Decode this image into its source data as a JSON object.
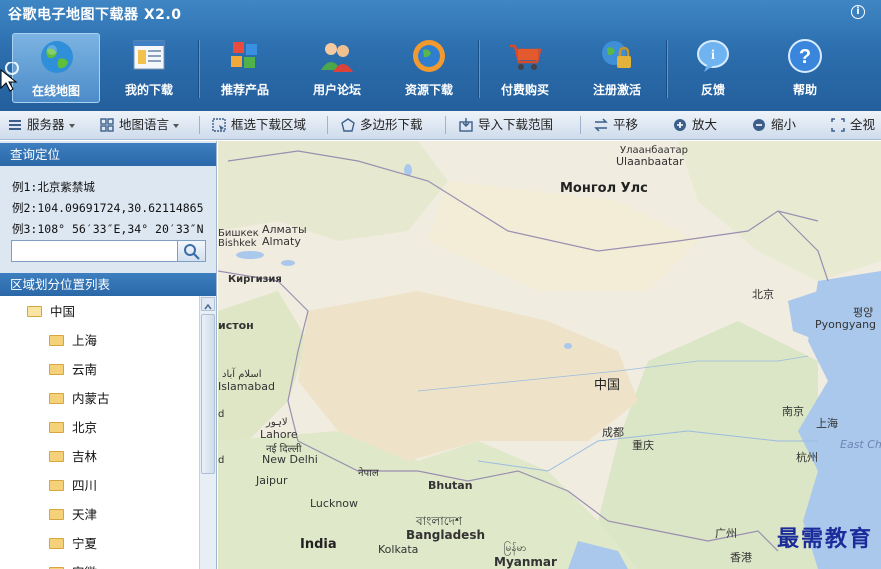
{
  "app": {
    "title": "谷歌电子地图下载器 X2.0",
    "info_icon": "info-icon"
  },
  "ribbon": {
    "buttons": [
      {
        "label": "在线地图",
        "icon": "globe-icon",
        "active": true
      },
      {
        "label": "我的下载",
        "icon": "download-list-icon",
        "active": false
      },
      {
        "label": "推荐产品",
        "icon": "cubes-icon",
        "active": false
      },
      {
        "label": "用户论坛",
        "icon": "users-icon",
        "active": false
      },
      {
        "label": "资源下载",
        "icon": "resource-globe-icon",
        "active": false
      },
      {
        "label": "付费购买",
        "icon": "cart-icon",
        "active": false
      },
      {
        "label": "注册激活",
        "icon": "lock-globe-icon",
        "active": false
      },
      {
        "label": "反馈",
        "icon": "feedback-icon",
        "active": false
      },
      {
        "label": "帮助",
        "icon": "help-icon",
        "active": false
      }
    ]
  },
  "toolbar": {
    "server": "服务器",
    "map_language": "地图语言",
    "box_select": "框选下载区域",
    "polygon": "多边形下载",
    "import_range": "导入下载范围",
    "pan": "平移",
    "zoom_in": "放大",
    "zoom_out": "缩小",
    "full_view": "全视"
  },
  "query": {
    "header": "查询定位",
    "example1": "例1:北京紫禁城",
    "example2": "例2:104.09691724,30.62114865",
    "example3": "例3:108° 56′33″E,34° 20′33″N",
    "search_value": ""
  },
  "regions": {
    "header": "区域划分位置列表",
    "root": "中国",
    "children": [
      "上海",
      "云南",
      "内蒙古",
      "北京",
      "吉林",
      "四川",
      "天津",
      "宁夏",
      "安徽"
    ]
  },
  "map": {
    "labels": {
      "ulaanbaatar_mn": "Улаанбаатар",
      "ulaanbaatar": "Ulaanbaatar",
      "mongolia": "Монгол Улс",
      "bishkek_ru": "Бишкек",
      "bishkek": "Bishkek",
      "almaty_ru": "Алматы",
      "almaty": "Almaty",
      "kyrgyzstan": "Киргизия",
      "pakistan_frag": "истон",
      "islamabad_ur": "اسلام آباد",
      "islamabad": "Islamabad",
      "lahore_ur": "لاہور",
      "lahore": "Lahore",
      "beijing": "北京",
      "pyongyang_ko": "평양",
      "pyongyang": "Pyongyang",
      "china": "中国",
      "nanjing": "南京",
      "shanghai": "上海",
      "east_china_sea": "East Ch",
      "hangzhou": "杭州",
      "chengdu": "成都",
      "chongqing": "重庆",
      "new_delhi_hi": "नई दिल्ली",
      "new_delhi": "New Delhi",
      "nepal_ne": "नेपाल",
      "jaipur": "Jaipur",
      "lucknow": "Lucknow",
      "bhutan": "Bhutan",
      "bangladesh_bn": "বাংলাদেশ",
      "bangladesh": "Bangladesh",
      "kolkata": "Kolkata",
      "india": "India",
      "myanmar_my": "မြန်မာ",
      "myanmar": "Myanmar",
      "guangzhou": "广州",
      "hongkong": "香港",
      "dr_frag": "d",
      "tr_frag": "d"
    },
    "watermark": "最需教育"
  },
  "colors": {
    "ribbon": "#2c6eae",
    "panel_header": "#2a68a8",
    "map_land": "#f0ecdf",
    "water": "#a9c8ec",
    "watermark": "#1b2c9a"
  }
}
